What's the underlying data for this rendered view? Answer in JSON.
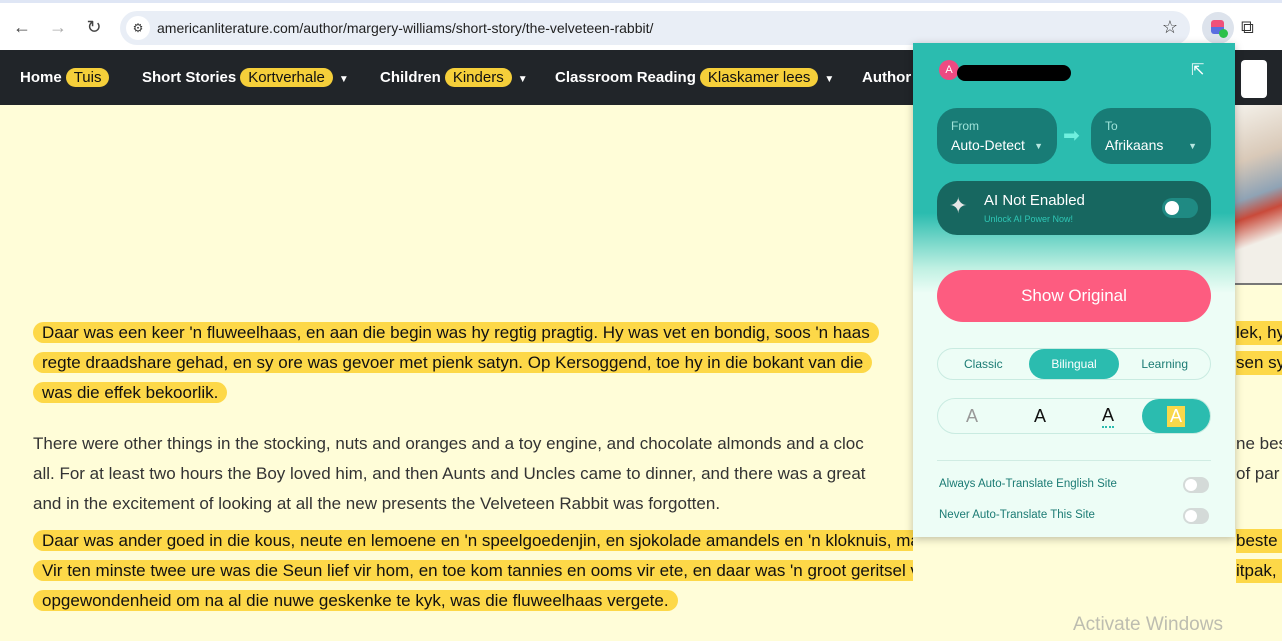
{
  "browser": {
    "url": "americanliterature.com/author/margery-williams/short-story/the-velveteen-rabbit/",
    "icons": [
      "back-icon",
      "forward-icon",
      "reload-icon",
      "site-settings-icon",
      "star-icon",
      "extension-icon",
      "puzzle-icon"
    ]
  },
  "nav": {
    "items": [
      {
        "label": "Home",
        "translation": "Tuis",
        "dropdown": false
      },
      {
        "label": "Short Stories",
        "translation": "Kortverhale",
        "dropdown": true
      },
      {
        "label": "Children",
        "translation": "Kinders",
        "dropdown": true
      },
      {
        "label": "Classroom Reading",
        "translation": "Klaskamer lees",
        "dropdown": true
      },
      {
        "label": "Author",
        "translation": "",
        "dropdown": false
      }
    ]
  },
  "content": {
    "lines": [
      {
        "text": "Daar was een keer 'n fluweelhaas, en aan die begin was hy regtig pragtig. Hy was vet en bondig, soos 'n haas",
        "right": "lek, hy",
        "hl": true
      },
      {
        "text": "regte draadshare gehad, en sy ore was gevoer met pienk satyn. Op Kersoggend, toe hy in die bokant van die",
        "right": "sen sy",
        "hl": true
      },
      {
        "text": "was die effek bekoorlik.",
        "right": "",
        "hl": true
      },
      {
        "text": "There were other things in the stocking, nuts and oranges and a toy engine, and chocolate almonds and a cloc",
        "right": "ne bes",
        "hl": false
      },
      {
        "text": "all. For at least two hours the Boy loved him, and then Aunts and Uncles came to dinner, and there was a great",
        "right": "of par",
        "hl": false
      },
      {
        "text": "and in the excitement of looking at all the new presents the Velveteen Rabbit was forgotten.",
        "right": "",
        "hl": false
      },
      {
        "text": "Daar was ander goed in die kous, neute en lemoene en 'n speelgoedenjin, en sjokolade amandels en 'n kloknuis, maar die Konyn was nogal die beste van",
        "right": "beste van",
        "hl": true
      },
      {
        "text": "Vir ten minste twee ure was die Seun lief vir hom, en toe kom tannies en ooms vir ete, en daar was 'n groot geritsel van sneespapier en pakkies uitpak, en in",
        "right": "itpak, en in",
        "hl": true
      },
      {
        "text": "opgewondenheid om na al die nuwe geskenke te kyk, was die fluweelhaas vergete.",
        "right": "",
        "hl": true
      }
    ]
  },
  "popup": {
    "avatar_letter": "A",
    "from_label": "From",
    "from_value": "Auto-Detect",
    "to_label": "To",
    "to_value": "Afrikaans",
    "ai_title": "AI Not Enabled",
    "ai_subtitle": "Unlock AI Power Now!",
    "ai_enabled": false,
    "show_original": "Show Original",
    "modes": [
      "Classic",
      "Bilingual",
      "Learning"
    ],
    "active_mode": "Bilingual",
    "styles": [
      "A",
      "A",
      "A",
      "A"
    ],
    "active_style": 3,
    "options": [
      {
        "label": "Always Auto-Translate English Site",
        "on": false
      },
      {
        "label": "Never Auto-Translate This Site",
        "on": false
      }
    ],
    "colors": {
      "teal": "#2bbcaf",
      "pink": "#fd5c80",
      "dark": "#176760"
    }
  },
  "watermark": "Activate Windows"
}
